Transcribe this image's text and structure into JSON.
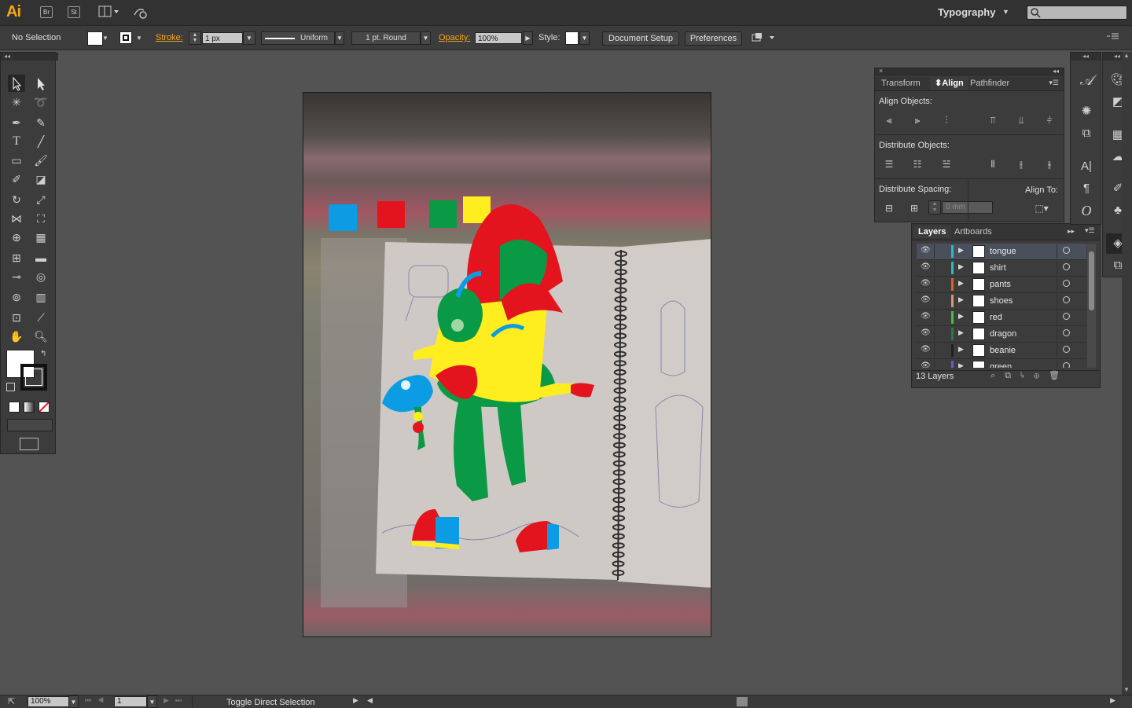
{
  "app": {
    "logo": "Ai",
    "bridge": "Br",
    "stock": "St",
    "workspace": "Typography"
  },
  "control_bar": {
    "selection": "No Selection",
    "stroke_label": "Stroke:",
    "stroke_weight": "1 px",
    "profile": "Uniform",
    "brush": "1 pt. Round",
    "opacity_label": "Opacity:",
    "opacity_value": "100%",
    "style_label": "Style:",
    "document_setup": "Document Setup",
    "preferences": "Preferences"
  },
  "align_panel": {
    "tabs": [
      "Transform",
      "Align",
      "Pathfinder"
    ],
    "active_tab": "Align",
    "align_objects": "Align Objects:",
    "distribute_objects": "Distribute Objects:",
    "distribute_spacing": "Distribute Spacing:",
    "align_to": "Align To:",
    "spacing_value": "0 mm"
  },
  "layers_panel": {
    "tabs": [
      "Layers",
      "Artboards"
    ],
    "active_tab": "Layers",
    "layers": [
      {
        "name": "tongue",
        "color": "#30b8c8",
        "selected": true
      },
      {
        "name": "shirt",
        "color": "#30b8c8",
        "selected": false
      },
      {
        "name": "pants",
        "color": "#e06030",
        "selected": false
      },
      {
        "name": "shoes",
        "color": "#d49a6a",
        "selected": false
      },
      {
        "name": "red",
        "color": "#40c040",
        "selected": false
      },
      {
        "name": "dragon",
        "color": "#208040",
        "selected": false
      },
      {
        "name": "beanie",
        "color": "#202020",
        "selected": false
      },
      {
        "name": "green",
        "color": "#6060d0",
        "selected": false
      }
    ],
    "count": "13 Layers"
  },
  "status_bar": {
    "zoom": "100%",
    "artboard": "1",
    "message": "Toggle Direct Selection"
  },
  "colors": {
    "accent": "#f7a51b",
    "swatch_blue": "#0b9ce3",
    "swatch_red": "#e3141e",
    "swatch_green": "#0a9a45",
    "swatch_yellow": "#ffee1f"
  }
}
